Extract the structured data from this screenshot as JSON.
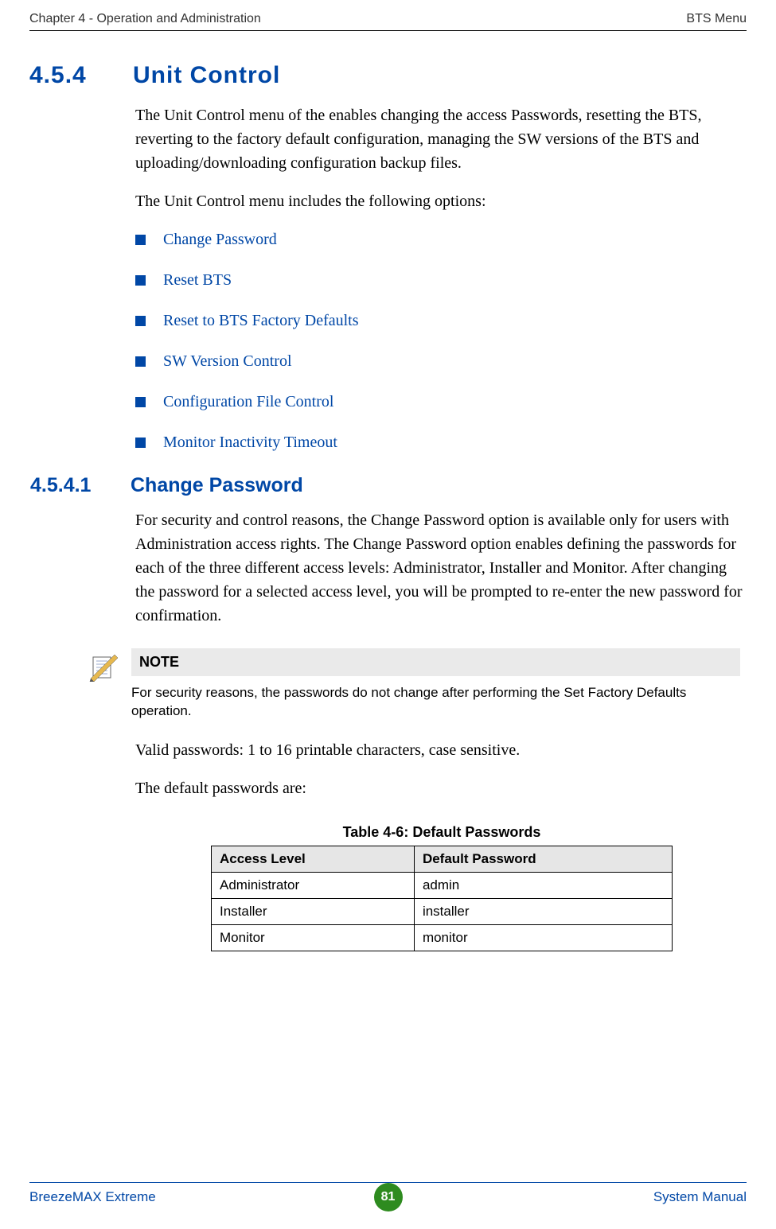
{
  "header": {
    "left": "Chapter 4 - Operation and Administration",
    "right": "BTS Menu"
  },
  "section": {
    "number": "4.5.4",
    "title": "Unit Control",
    "intro1": "The Unit Control menu of the enables changing the access Passwords, resetting the BTS, reverting to the factory default configuration, managing the SW versions of the BTS and uploading/downloading configuration backup files.",
    "intro2": "The Unit Control menu includes the following options:",
    "options": [
      "Change Password",
      "Reset BTS",
      "Reset to BTS Factory Defaults",
      "SW Version Control",
      "Configuration File Control",
      "Monitor Inactivity Timeout"
    ]
  },
  "subsection": {
    "number": "4.5.4.1",
    "title": "Change Password",
    "para": "For security and control reasons, the Change Password option is available only for users with Administration access rights. The Change Password option enables defining the passwords for each of the three different access levels: Administrator, Installer and Monitor. After changing the password for a selected access level, you will be prompted to re-enter the new password for confirmation."
  },
  "note": {
    "label": "NOTE",
    "text": "For security reasons, the passwords do not change after performing the Set Factory Defaults operation."
  },
  "postnote": {
    "para1": "Valid passwords: 1 to 16 printable characters, case sensitive.",
    "para2": "The default passwords are:"
  },
  "table": {
    "caption": "Table 4-6: Default Passwords",
    "headers": [
      "Access Level",
      "Default Password"
    ],
    "rows": [
      [
        "Administrator",
        "admin"
      ],
      [
        "Installer",
        "installer"
      ],
      [
        "Monitor",
        "monitor"
      ]
    ]
  },
  "footer": {
    "left": "BreezeMAX Extreme",
    "page": "81",
    "right": "System Manual"
  }
}
